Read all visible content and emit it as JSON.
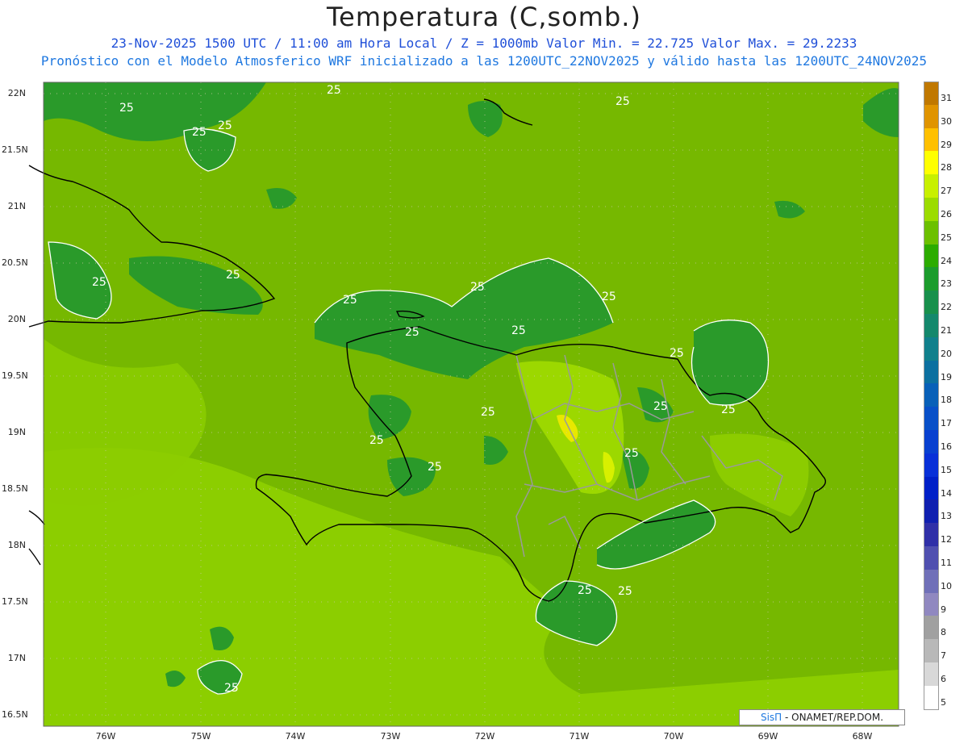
{
  "header": {
    "title": "Temperatura (C,somb.)",
    "line1": "23-Nov-2025 1500 UTC / 11:00 am Hora Local / Z = 1000mb   Valor Min. = 22.725  Valor Max. = 29.2233",
    "line2": "Pronóstico con el Modelo Atmosferico WRF inicializado a las 1200UTC_22NOV2025 y válido hasta las  1200UTC_24NOV2025"
  },
  "axes": {
    "lat_labels": [
      "22N",
      "21.5N",
      "21N",
      "20.5N",
      "20N",
      "19.5N",
      "19N",
      "18.5N",
      "18N",
      "17.5N",
      "17N",
      "16.5N"
    ],
    "lon_labels": [
      "76W",
      "75W",
      "74W",
      "73W",
      "72W",
      "71W",
      "70W",
      "69W",
      "68W"
    ]
  },
  "contour_label": "25",
  "colorbar": {
    "levels": [
      "31",
      "30",
      "29",
      "28",
      "27",
      "26",
      "25",
      "24",
      "23",
      "22",
      "21",
      "20",
      "19",
      "18",
      "17",
      "16",
      "15",
      "14",
      "13",
      "12",
      "11",
      "10",
      "9",
      "8",
      "7",
      "6",
      "5"
    ],
    "colors": [
      "#c07800",
      "#e09400",
      "#ffc000",
      "#ffff00",
      "#c8f000",
      "#9cdc00",
      "#6cc000",
      "#2cac00",
      "#1c9c2c",
      "#18904c",
      "#14886c",
      "#10808c",
      "#0c70a0",
      "#0860b8",
      "#0850c8",
      "#0840d0",
      "#0830d8",
      "#0020c8",
      "#1020b0",
      "#3030a8",
      "#5050b0",
      "#7070b8",
      "#9088c0",
      "#a0a0a0",
      "#b8b8b8",
      "#d8d8d8",
      "#ffffff"
    ]
  },
  "colors": {
    "base_field": "#7bbf00",
    "warm_field": "#9cd800",
    "cool_field": "#2a9a2a",
    "hot_field": "#c8f000",
    "coast": "#000000",
    "borders": "#999999",
    "contour": "#ffffff"
  },
  "credit": {
    "brand": "SisΠ",
    "text": " - ONAMET/REP.DOM."
  }
}
